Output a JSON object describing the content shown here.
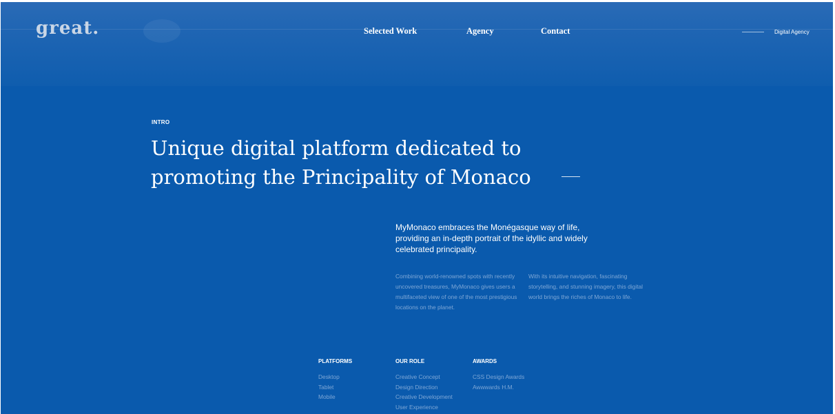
{
  "header": {
    "logo": "great.",
    "nav": [
      "Selected Work",
      "Agency",
      "Contact"
    ],
    "tagline": "Digital Agency"
  },
  "intro": {
    "label": "INTRO",
    "headline_line1": "Unique digital platform dedicated to",
    "headline_line2": "promoting the Principality of Monaco",
    "lead": "MyMonaco embraces the Monégasque way of life, providing an in-depth portrait of the idyllic and widely celebrated principality.",
    "body_left": "Combining world-renowned spots with recently uncovered treasures, MyMonaco gives users a multifaceted view of one of the most prestigious locations on the planet.",
    "body_right": "With its intuitive navigation, fascinating storytelling, and stunning imagery, this digital world brings the riches of Monaco to life."
  },
  "details": {
    "platforms": {
      "title": "PLATFORMS",
      "items": [
        "Desktop",
        "Tablet",
        "Mobile"
      ]
    },
    "role": {
      "title": "OUR ROLE",
      "items": [
        "Creative Concept",
        "Design Direction",
        "Creative Development",
        "User Experience"
      ]
    },
    "awards": {
      "title": "AWARDS",
      "items": [
        "CSS Design Awards",
        "Awwwards H.M."
      ]
    }
  },
  "colors": {
    "background": "#0a5aad",
    "text_primary": "#ffffff",
    "text_muted": "#7ea7d6"
  }
}
